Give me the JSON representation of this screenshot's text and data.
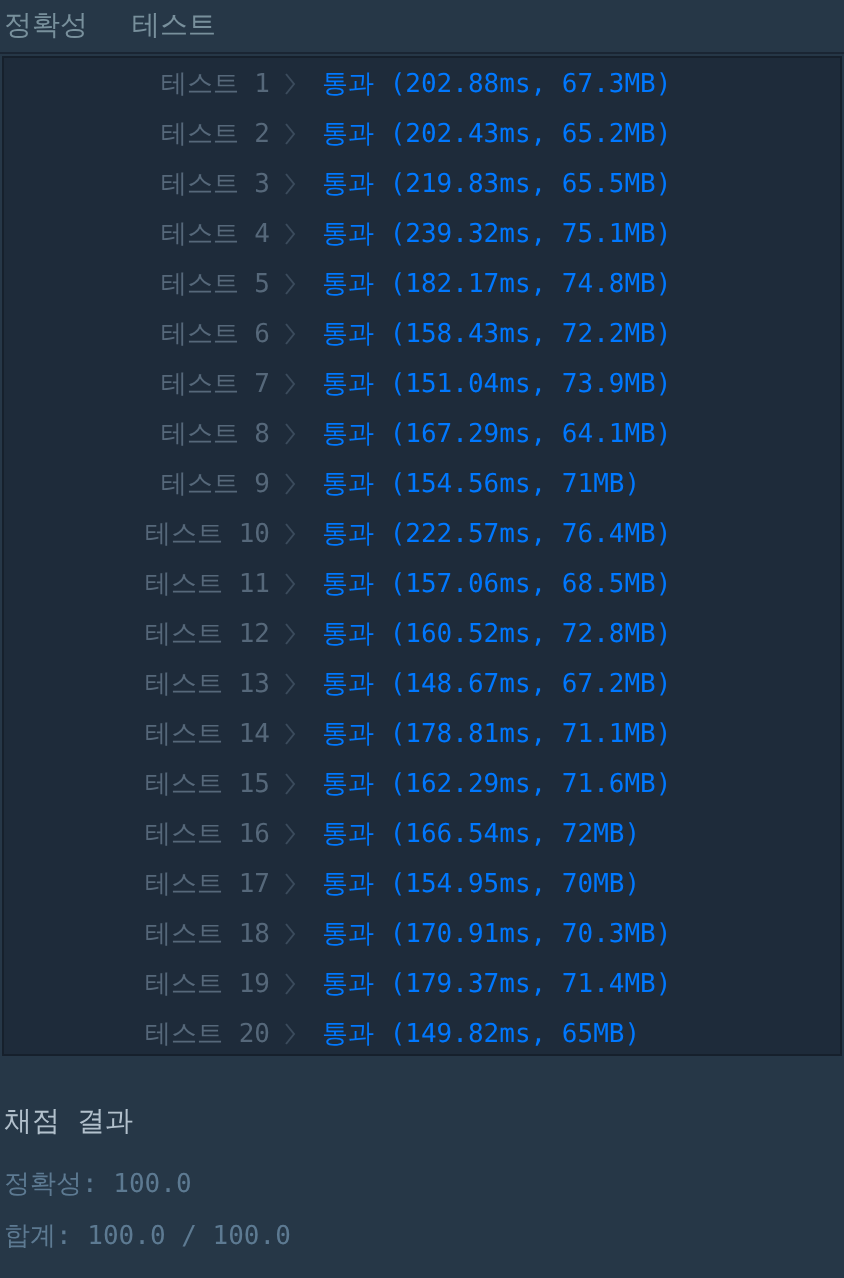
{
  "tabs": [
    {
      "label": "정확성"
    },
    {
      "label": "테스트"
    }
  ],
  "tests": [
    {
      "label": "테스트 1",
      "result": "통과 (202.88ms, 67.3MB)"
    },
    {
      "label": "테스트 2",
      "result": "통과 (202.43ms, 65.2MB)"
    },
    {
      "label": "테스트 3",
      "result": "통과 (219.83ms, 65.5MB)"
    },
    {
      "label": "테스트 4",
      "result": "통과 (239.32ms, 75.1MB)"
    },
    {
      "label": "테스트 5",
      "result": "통과 (182.17ms, 74.8MB)"
    },
    {
      "label": "테스트 6",
      "result": "통과 (158.43ms, 72.2MB)"
    },
    {
      "label": "테스트 7",
      "result": "통과 (151.04ms, 73.9MB)"
    },
    {
      "label": "테스트 8",
      "result": "통과 (167.29ms, 64.1MB)"
    },
    {
      "label": "테스트 9",
      "result": "통과 (154.56ms, 71MB)"
    },
    {
      "label": "테스트 10",
      "result": "통과 (222.57ms, 76.4MB)"
    },
    {
      "label": "테스트 11",
      "result": "통과 (157.06ms, 68.5MB)"
    },
    {
      "label": "테스트 12",
      "result": "통과 (160.52ms, 72.8MB)"
    },
    {
      "label": "테스트 13",
      "result": "통과 (148.67ms, 67.2MB)"
    },
    {
      "label": "테스트 14",
      "result": "통과 (178.81ms, 71.1MB)"
    },
    {
      "label": "테스트 15",
      "result": "통과 (162.29ms, 71.6MB)"
    },
    {
      "label": "테스트 16",
      "result": "통과 (166.54ms, 72MB)"
    },
    {
      "label": "테스트 17",
      "result": "통과 (154.95ms, 70MB)"
    },
    {
      "label": "테스트 18",
      "result": "통과 (170.91ms, 70.3MB)"
    },
    {
      "label": "테스트 19",
      "result": "통과 (179.37ms, 71.4MB)"
    },
    {
      "label": "테스트 20",
      "result": "통과 (149.82ms, 65MB)"
    }
  ],
  "summary": {
    "title": "채점 결과",
    "lines": [
      "정확성: 100.0",
      "합계: 100.0 / 100.0"
    ]
  }
}
